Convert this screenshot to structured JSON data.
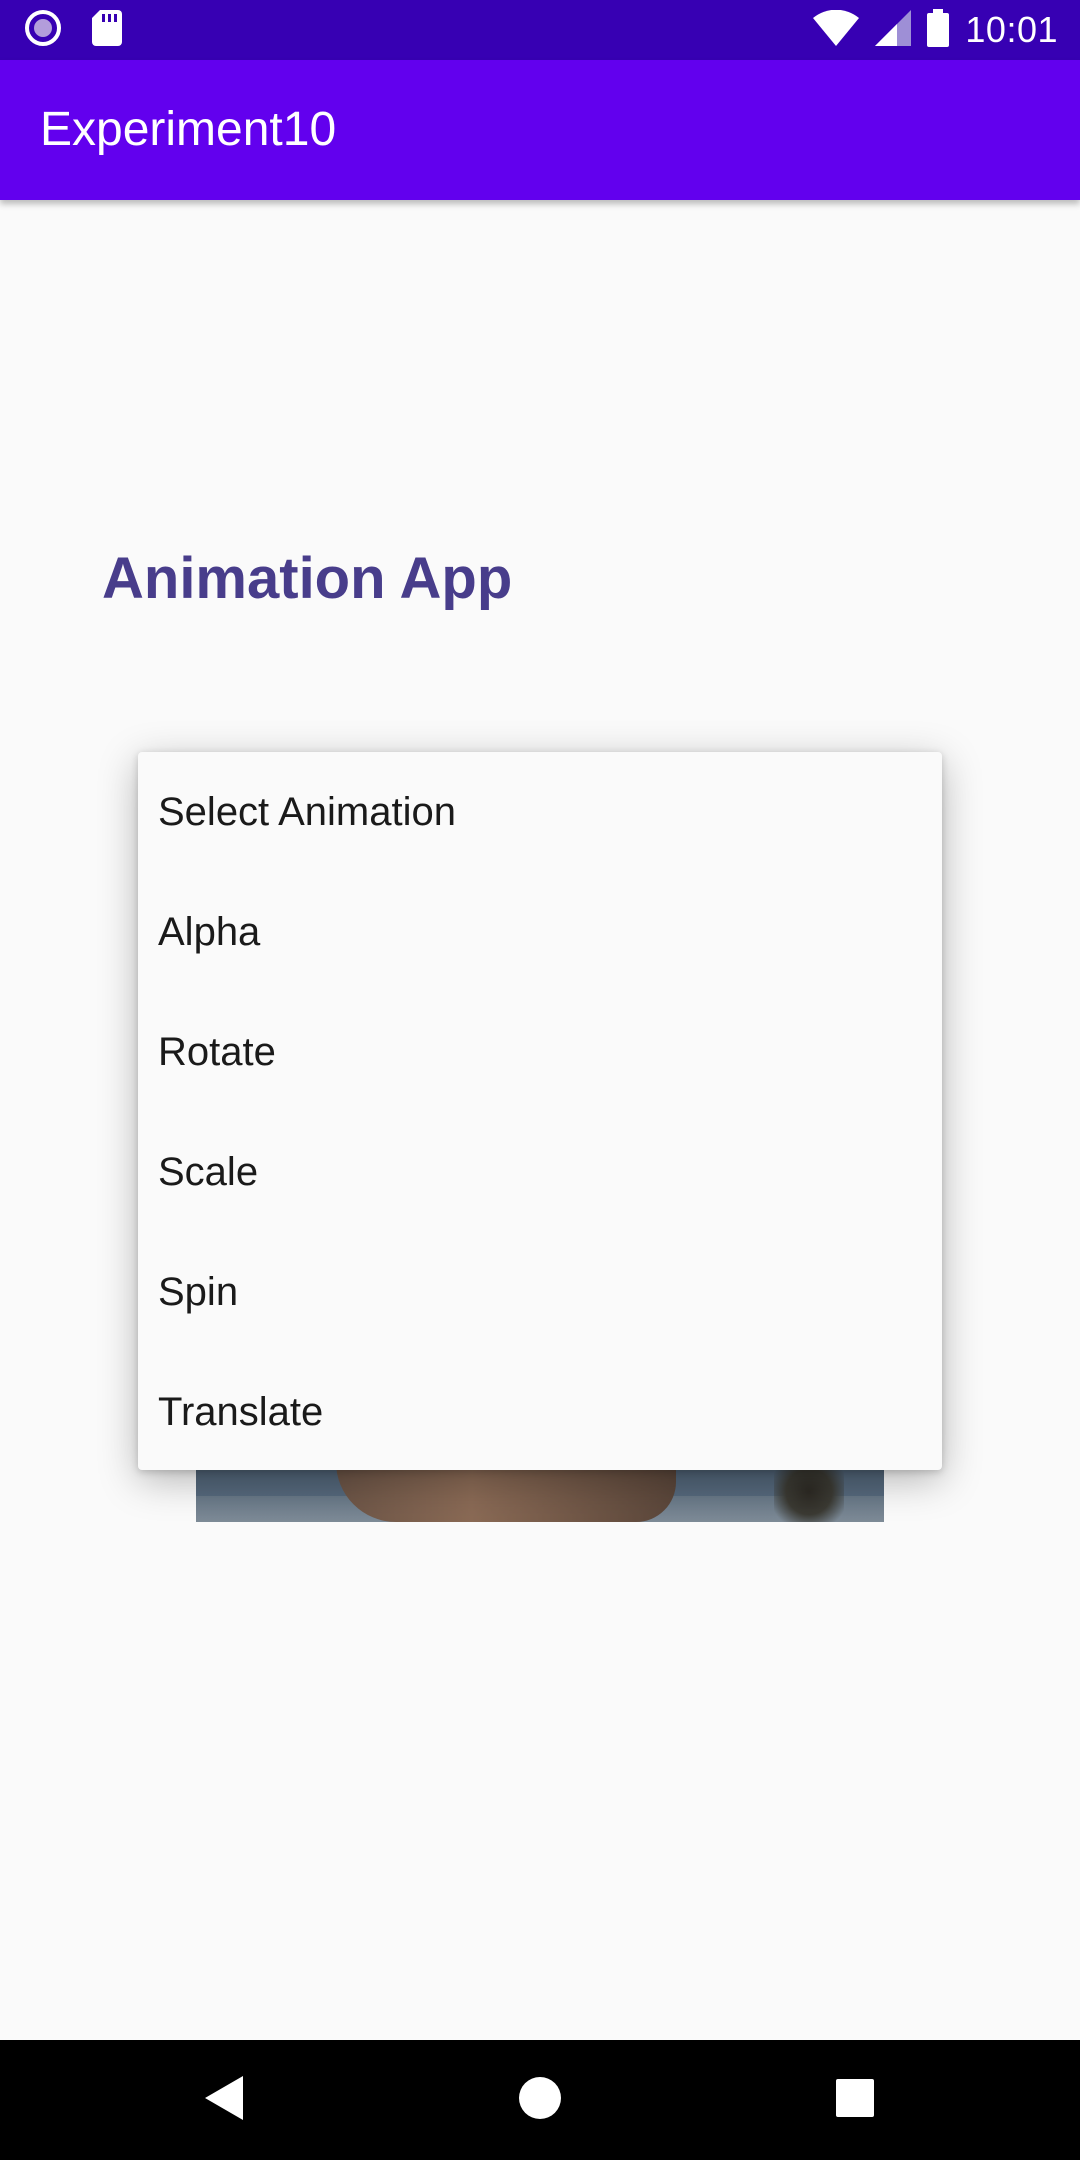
{
  "status_bar": {
    "time": "10:01",
    "icons": [
      "notification-dot-icon",
      "sd-card-icon",
      "wifi-icon",
      "cell-signal-icon",
      "battery-icon"
    ],
    "background": "#3700b3"
  },
  "app_bar": {
    "title": "Experiment10",
    "background": "#6200ee"
  },
  "main": {
    "heading": "Animation App",
    "heading_color": "#483d8b"
  },
  "dropdown": {
    "items": [
      {
        "label": "Select Animation"
      },
      {
        "label": "Alpha"
      },
      {
        "label": "Rotate"
      },
      {
        "label": "Scale"
      },
      {
        "label": "Spin"
      },
      {
        "label": "Translate"
      }
    ]
  },
  "nav_bar": {
    "buttons": [
      "back-icon",
      "home-icon",
      "recents-icon"
    ]
  }
}
